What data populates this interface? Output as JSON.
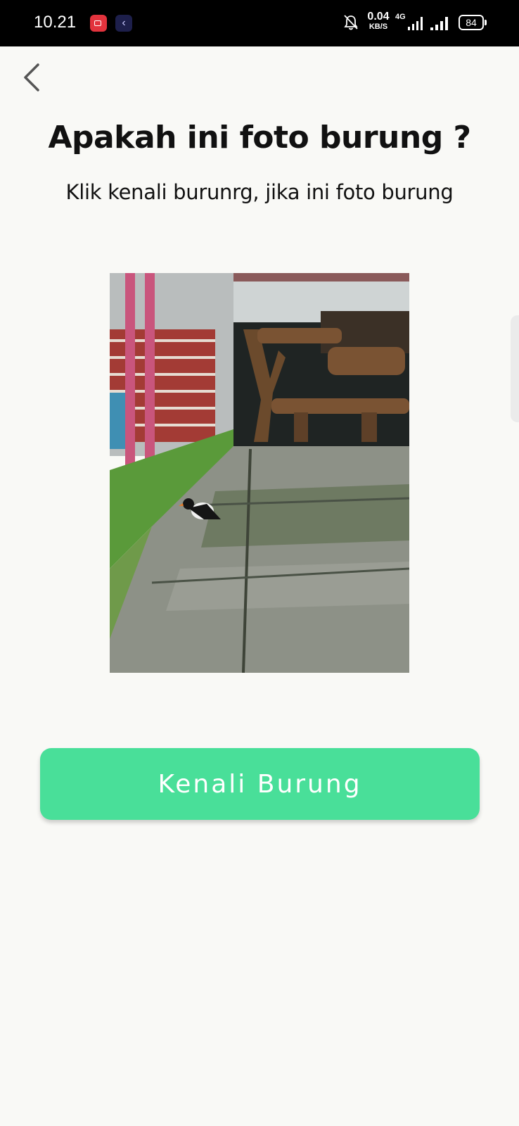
{
  "status_bar": {
    "time": "10.21",
    "speed_value": "0.04",
    "speed_unit": "KB/S",
    "network": "4G",
    "battery": "84"
  },
  "icons": {
    "back": "chevron-left-icon",
    "notification": "bell-off-icon",
    "app1": "video-record-icon",
    "app2": "back-arrow-app-icon"
  },
  "header": {
    "title": "Apakah ini foto burung ?",
    "subtitle": "Klik kenali burunrg, jika ini foto burung"
  },
  "photo": {
    "alt": ""
  },
  "action": {
    "button_label": "Kenali Burung"
  },
  "colors": {
    "accent": "#49df99",
    "background": "#f9f9f6",
    "text": "#111111"
  }
}
